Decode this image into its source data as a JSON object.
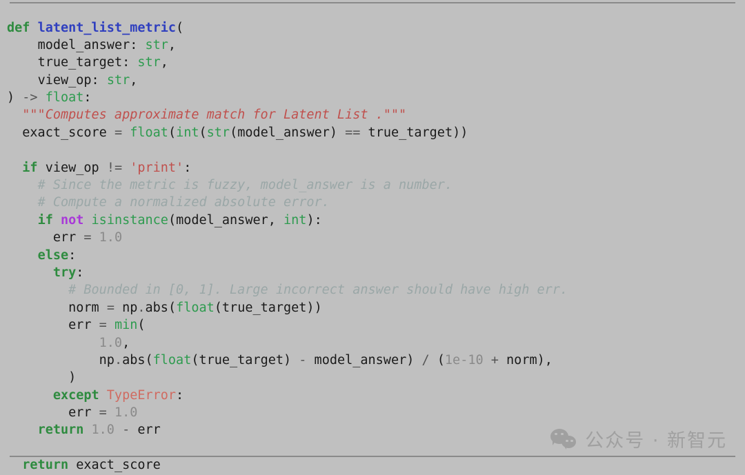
{
  "window": {
    "title": "latent_list_metric",
    "background_color": "#c0c0c0",
    "rule_color": "#8a8a8a"
  },
  "theme": {
    "keyword_color": "#2e8b3f",
    "keyword_operator_color": "#a838d8",
    "function_name_color": "#2f3fbf",
    "builtin_color": "#2e9b4f",
    "number_color": "#8a8a8a",
    "string_color": "#c0504d",
    "docstring_color": "#c0504d",
    "comment_color": "#9aa7a7",
    "exception_color": "#d06a60",
    "operator_color": "#555555",
    "plain_color": "#1a1a1a"
  },
  "code": {
    "language": "python",
    "lines": [
      "def latent_list_metric(",
      "    model_answer: str,",
      "    true_target: str,",
      "    view_op: str,",
      ") -> float:",
      "  \"\"\"Computes approximate match for Latent List .\"\"\"",
      "  exact_score = float(int(str(model_answer) == true_target))",
      "",
      "  if view_op != 'print':",
      "    # Since the metric is fuzzy, model_answer is a number.",
      "    # Compute a normalized absolute error.",
      "    if not isinstance(model_answer, int):",
      "      err = 1.0",
      "    else:",
      "      try:",
      "        # Bounded in [0, 1]. Large incorrect answer should have high err.",
      "        norm = np.abs(float(true_target))",
      "        err = min(",
      "            1.0,",
      "            np.abs(float(true_target) - model_answer) / (1e-10 + norm),",
      "        )",
      "      except TypeError:",
      "        err = 1.0",
      "    return 1.0 - err",
      "",
      "  return exact_score"
    ],
    "tokens": {
      "keywords": [
        "def",
        "if",
        "else",
        "try",
        "except",
        "return"
      ],
      "keyword_operators": [
        "not"
      ],
      "function_name": "latent_list_metric",
      "parameters": [
        "model_answer",
        "true_target",
        "view_op"
      ],
      "annotations": [
        "str",
        "str",
        "str"
      ],
      "return_type": "float",
      "builtins": [
        "float",
        "int",
        "str",
        "isinstance",
        "min",
        "float"
      ],
      "numbers": [
        "1.0",
        "1.0",
        "1.0",
        "1e-10",
        "1.0",
        "1.0"
      ],
      "strings": [
        "'print'"
      ],
      "exception": "TypeError",
      "docstring": "\"\"\"Computes approximate match for Latent List .\"\"\"",
      "comments": [
        "# Since the metric is fuzzy, model_answer is a number.",
        "# Compute a normalized absolute error.",
        "# Bounded in [0, 1]. Large incorrect answer should have high err."
      ],
      "variables": [
        "exact_score",
        "err",
        "norm",
        "np"
      ]
    }
  },
  "watermark": {
    "icon": "wechat-icon",
    "text": "公众号 · 新智元"
  }
}
